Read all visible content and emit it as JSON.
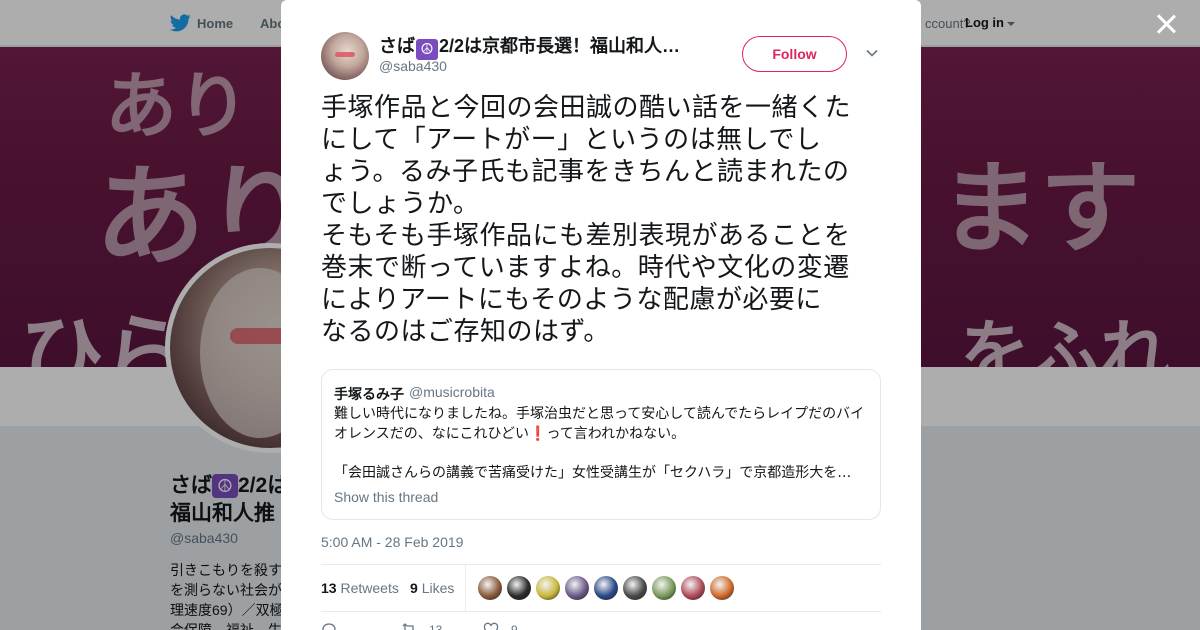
{
  "nav": {
    "home_label": "Home",
    "about_label": "Abo",
    "account_text": "ccount?",
    "login_label": "Log in"
  },
  "banner": {
    "text1": "あり",
    "text2": "あり",
    "text3": "ます",
    "text4": "ひら",
    "text5": "をふれ"
  },
  "profile": {
    "name_part1": "さば",
    "peace_symbol": "☮",
    "name_part2": "2/2は",
    "name_line2": "福山和人推",
    "handle": "@saba430",
    "bio_lines": [
      "引きこもりを殺す",
      "を測らない社会が",
      "理速度69）／双極",
      "会保障、福祉、生"
    ]
  },
  "tweet": {
    "author_name_prefix": "さば",
    "author_peace": "☮",
    "author_name_suffix": "2/2は京都市長選！福山和人…",
    "author_handle": "@saba430",
    "follow_label": "Follow",
    "text": "手塚作品と今回の会田誠の酷い話を一緒くた\nにして「アートがー」というのは無しでし\nょう。るみ子氏も記事をきちんと読まれたの\nでしょうか。\nそもそも手塚作品にも差別表現があることを\n巻末で断っていますよね。時代や文化の変遷\nによりアートにもそのような配慮が必要に\nなるのはご存知のはず。",
    "quote": {
      "name": "手塚るみ子",
      "handle": "@musicrobita",
      "text_a": "難しい時代になりましたね。手塚治虫だと思って安心して読んでたらレイプだのバイ\nオレンスだの、なにこれひどい",
      "exclamation": "❗",
      "text_b": "って言われかねない。",
      "text_2": "「会田誠さんらの講義で苦痛受けた」女性受講生が「セクハラ」で京都造形大を…",
      "show_thread": "Show this thread"
    },
    "timestamp": "5:00 AM - 28 Feb 2019",
    "retweets_count": "13",
    "retweets_label": "Retweets",
    "likes_count": "9",
    "likes_label": "Likes",
    "liker_colors": [
      "#8a5a3c",
      "#2b2b2b",
      "#c8b93a",
      "#6b5a8a",
      "#2b4a8a",
      "#4a4a4a",
      "#7a9a5a",
      "#b04a5a",
      "#d06a2a"
    ],
    "actions": {
      "retweets": "13",
      "likes": "9"
    }
  },
  "colors": {
    "accent_like": "#e0245e",
    "text_secondary": "#657786",
    "banner": "#6a1a45"
  }
}
